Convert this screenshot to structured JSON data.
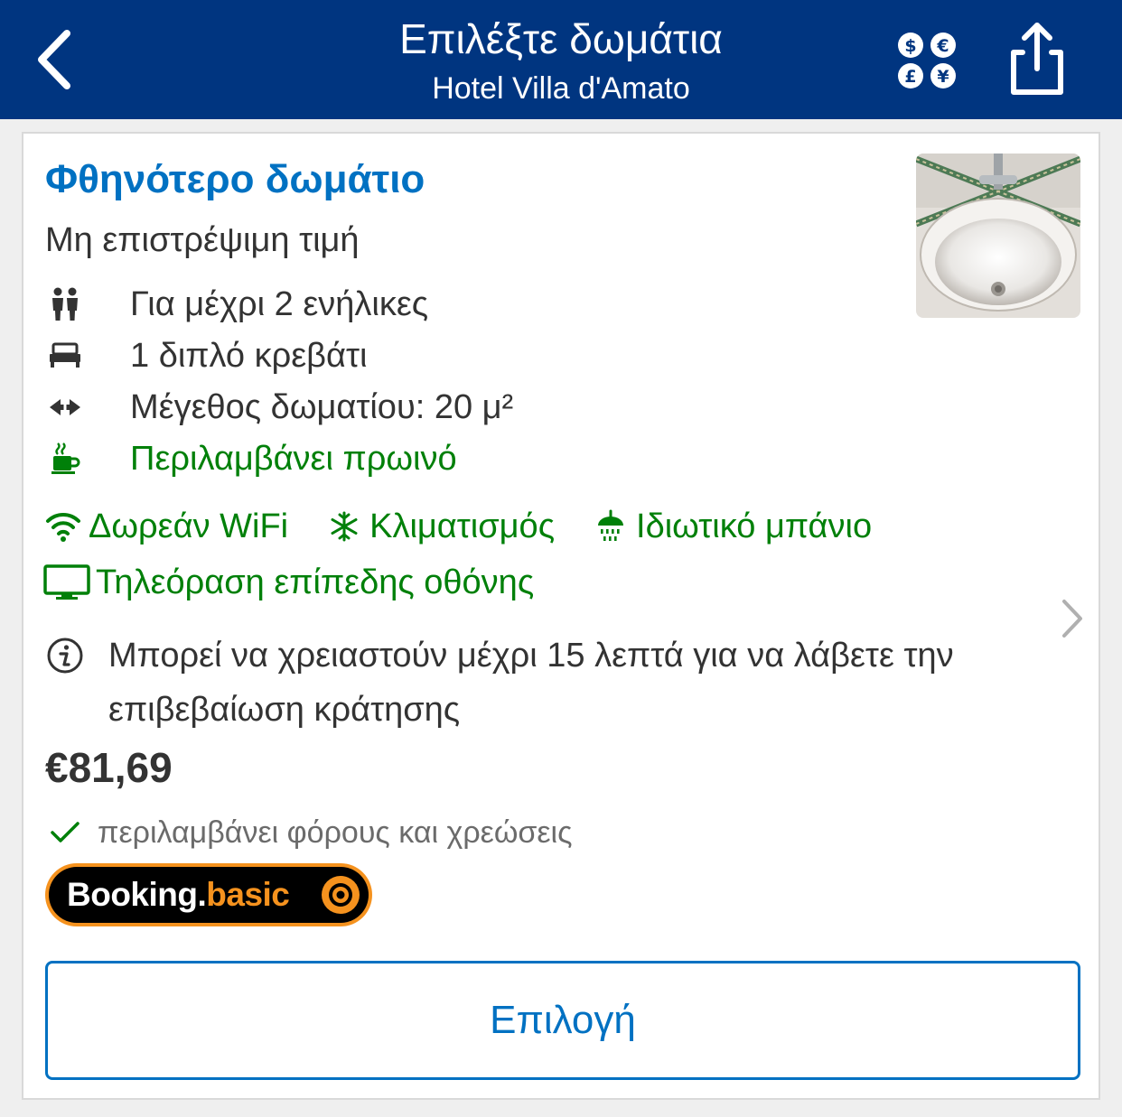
{
  "header": {
    "title": "Επιλέξτε δωμάτια",
    "subtitle": "Hotel Villa d'Amato",
    "back_icon": "chevron-left-icon",
    "currency_icon": "currency-icon",
    "share_icon": "share-icon"
  },
  "room": {
    "title": "Φθηνότερο δωμάτιο",
    "rate_type": "Μη επιστρέψιμη τιμή",
    "photo_alt": "bathroom sink",
    "facts": [
      {
        "icon": "guests-icon",
        "text": "Για μέχρι 2 ενήλικες"
      },
      {
        "icon": "bed-icon",
        "text": "1 διπλό κρεβάτι"
      },
      {
        "icon": "room-size-icon",
        "text": "Μέγεθος δωματίου: 20 μ²"
      },
      {
        "icon": "coffee-icon",
        "text": "Περιλαμβάνει πρωινό"
      }
    ],
    "amenities": [
      {
        "icon": "wifi-icon",
        "text": "Δωρεάν WiFi"
      },
      {
        "icon": "snowflake-icon",
        "text": "Κλιματισμός"
      },
      {
        "icon": "shower-icon",
        "text": "Ιδιωτικό μπάνιο"
      },
      {
        "icon": "tv-icon",
        "text": "Τηλεόραση επίπεδης οθόνης"
      }
    ],
    "info_text": "Μπορεί να χρειαστούν μέχρι 15 λεπτά για να λάβετε την επιβεβαίωση κράτησης",
    "price": "€81,69",
    "tax_note": "περιλαμβάνει φόρους και χρεώσεις",
    "badge": {
      "part1": "Booking",
      "part2": ".",
      "part3": "basic"
    },
    "select_label": "Επιλογή"
  },
  "colors": {
    "header_bg": "#003580",
    "brand_blue": "#0071c2",
    "green": "#008009",
    "badge_orange": "#f5921e"
  }
}
